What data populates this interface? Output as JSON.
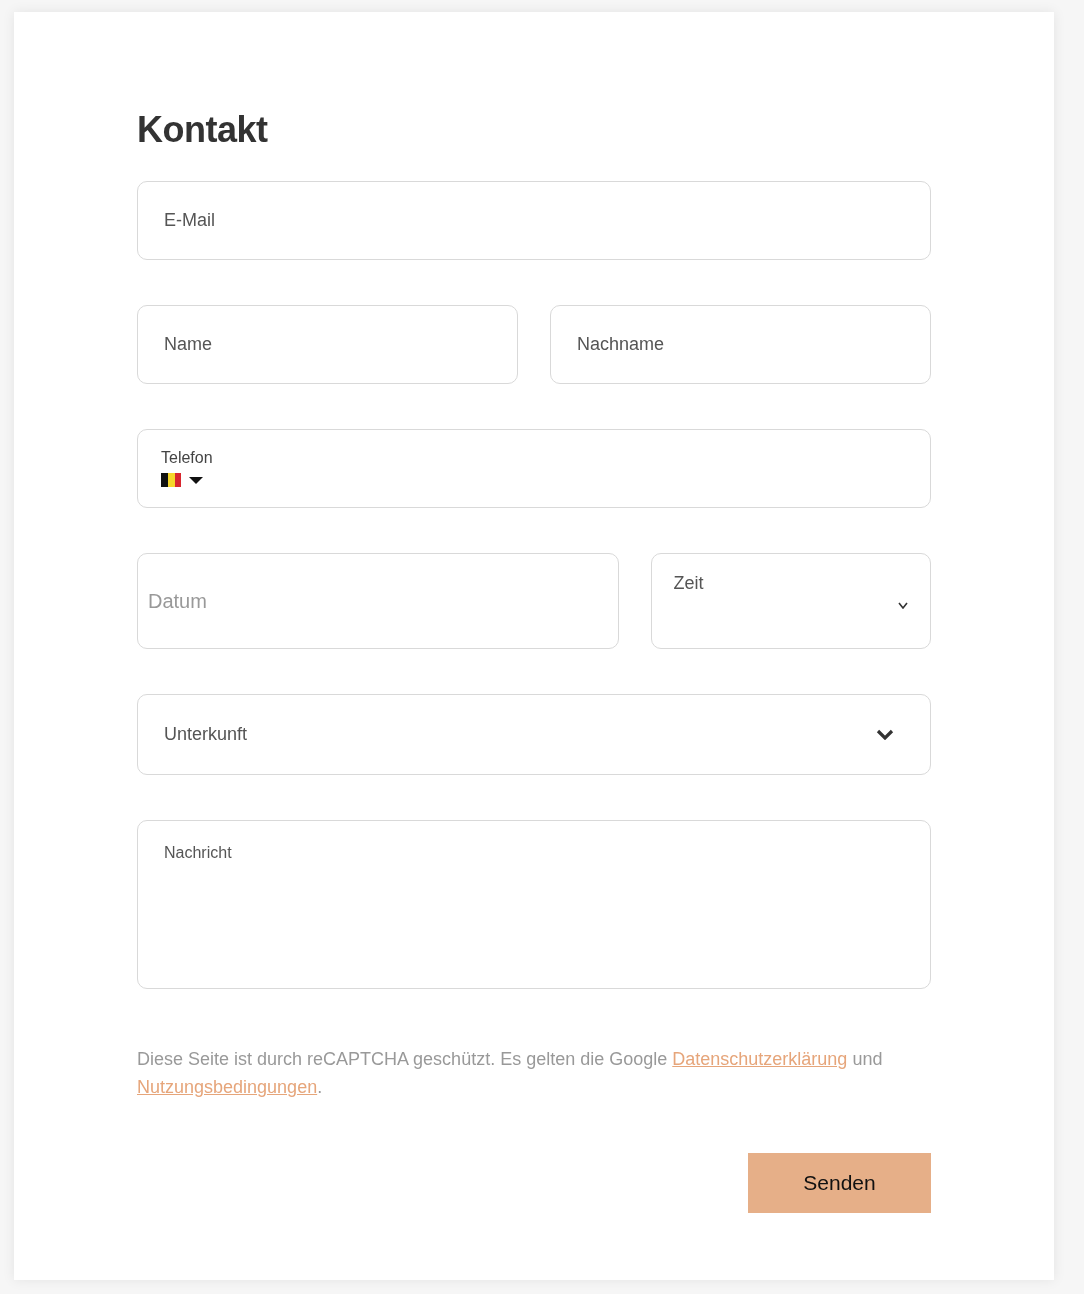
{
  "title": "Kontakt",
  "rows": [
    [
      {
        "kind": "input",
        "placeholder": "E-Mail"
      }
    ],
    [
      {
        "kind": "input",
        "placeholder": "Name"
      },
      {
        "kind": "input",
        "placeholder": "Nachname"
      }
    ],
    [
      {
        "kind": "phone",
        "label": "Telefon"
      }
    ],
    [
      {
        "kind": "date",
        "placeholder": "Datum"
      },
      {
        "kind": "time",
        "label": "Zeit"
      }
    ],
    [
      {
        "kind": "select",
        "placeholder": "Unterkunft"
      }
    ],
    [
      {
        "kind": "textarea",
        "placeholder": "Nachricht"
      }
    ]
  ],
  "notice": [
    {
      "kind": "text",
      "text": "Diese Seite ist durch reCAPTCHA geschützt. Es gelten die Google "
    },
    {
      "kind": "link",
      "text": "Datenschutzerklärung"
    },
    {
      "kind": "text",
      "text": " und "
    },
    {
      "kind": "link",
      "text": "Nutzungsbedingungen"
    },
    {
      "kind": "text",
      "text": "."
    }
  ],
  "submit": "Senden"
}
